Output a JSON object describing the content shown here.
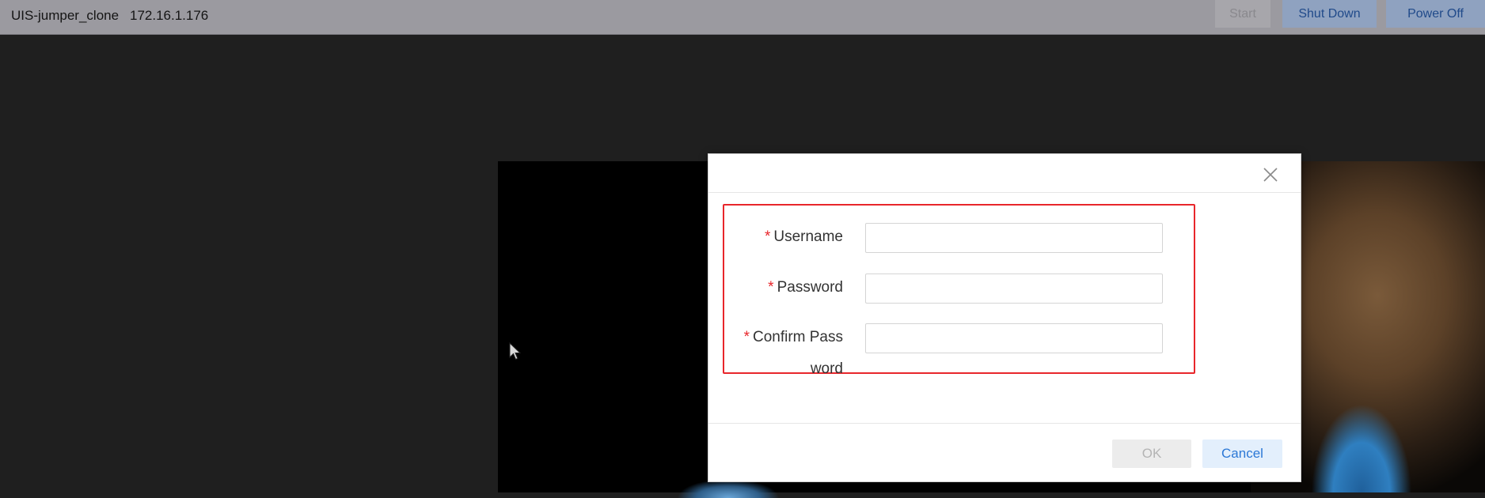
{
  "topbar": {
    "vm_name": "UIS-jumper_clone",
    "vm_ip": "172.16.1.176",
    "start_label": "Start",
    "shutdown_label": "Shut Down",
    "poweroff_label": "Power Off"
  },
  "dialog": {
    "fields": [
      {
        "required_mark": "*",
        "label": "Username",
        "value": ""
      },
      {
        "required_mark": "*",
        "label": "Password",
        "value": ""
      },
      {
        "required_mark": "*",
        "label_line1": "Confirm Pass",
        "label_line2": "word",
        "value": ""
      }
    ],
    "ok_label": "OK",
    "cancel_label": "Cancel"
  },
  "icons": {
    "close": "close-icon",
    "cursor": "mouse-pointer-icon"
  },
  "colors": {
    "highlight": "#e8262b",
    "accent": "#2b78d6",
    "required": "#e8262b"
  }
}
